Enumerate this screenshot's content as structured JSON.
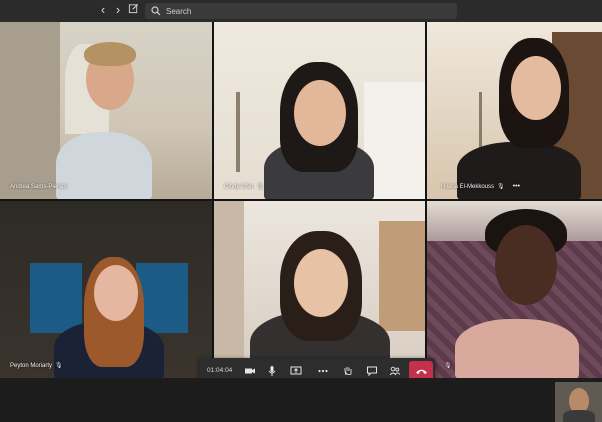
{
  "toolbar": {
    "back_icon": "chevron-left-icon",
    "forward_icon": "chevron-right-icon",
    "compose_icon": "compose-icon",
    "search_placeholder": "Search"
  },
  "participants": [
    {
      "name": "Andrea Sams-Piersol"
    },
    {
      "name": "Cindy Chin"
    },
    {
      "name": "Hilana El-Mekkouss"
    },
    {
      "name": "Peyton Moriarty"
    },
    {
      "name": ""
    },
    {
      "name": ""
    }
  ],
  "call": {
    "timer": "01:04:04",
    "hangup_color": "#c4314b"
  }
}
